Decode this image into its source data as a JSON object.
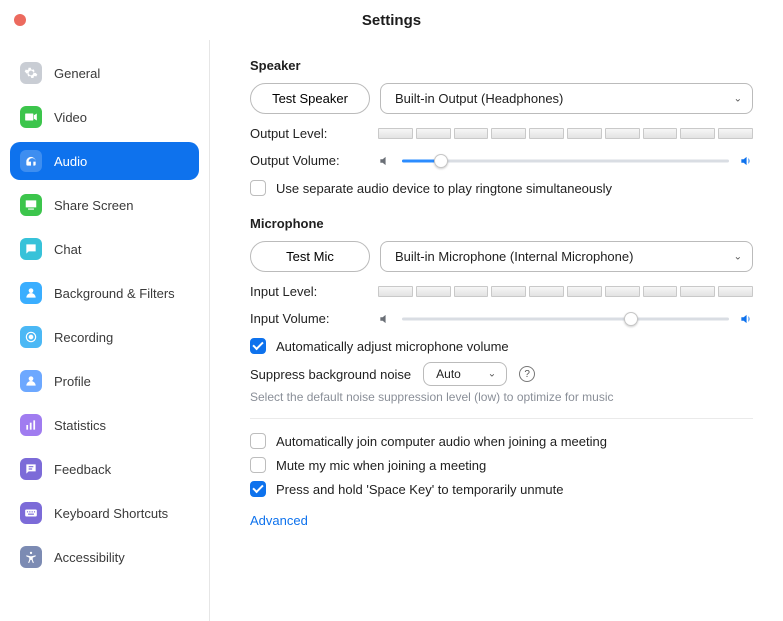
{
  "title": "Settings",
  "sidebar": {
    "items": [
      {
        "id": "general",
        "label": "General"
      },
      {
        "id": "video",
        "label": "Video"
      },
      {
        "id": "audio",
        "label": "Audio"
      },
      {
        "id": "share-screen",
        "label": "Share Screen"
      },
      {
        "id": "chat",
        "label": "Chat"
      },
      {
        "id": "background-filters",
        "label": "Background & Filters"
      },
      {
        "id": "recording",
        "label": "Recording"
      },
      {
        "id": "profile",
        "label": "Profile"
      },
      {
        "id": "statistics",
        "label": "Statistics"
      },
      {
        "id": "feedback",
        "label": "Feedback"
      },
      {
        "id": "keyboard-shortcuts",
        "label": "Keyboard Shortcuts"
      },
      {
        "id": "accessibility",
        "label": "Accessibility"
      }
    ],
    "active": "audio"
  },
  "speaker": {
    "title": "Speaker",
    "test_label": "Test Speaker",
    "device": "Built-in Output (Headphones)",
    "output_level_label": "Output Level:",
    "output_volume_label": "Output Volume:",
    "output_volume_percent": 12,
    "separate_device_label": "Use separate audio device to play ringtone simultaneously",
    "separate_device_checked": false
  },
  "microphone": {
    "title": "Microphone",
    "test_label": "Test Mic",
    "device": "Built-in Microphone (Internal Microphone)",
    "input_level_label": "Input Level:",
    "input_volume_label": "Input Volume:",
    "input_volume_percent": 70,
    "auto_adjust_label": "Automatically adjust microphone volume",
    "auto_adjust_checked": true,
    "suppress_label": "Suppress background noise",
    "suppress_value": "Auto",
    "suppress_hint": "Select the default noise suppression level (low) to optimize for music"
  },
  "options": {
    "auto_join_label": "Automatically join computer audio when joining a meeting",
    "auto_join_checked": false,
    "mute_join_label": "Mute my mic when joining a meeting",
    "mute_join_checked": false,
    "hold_space_label": "Press and hold 'Space Key' to temporarily unmute",
    "hold_space_checked": true
  },
  "advanced_label": "Advanced"
}
